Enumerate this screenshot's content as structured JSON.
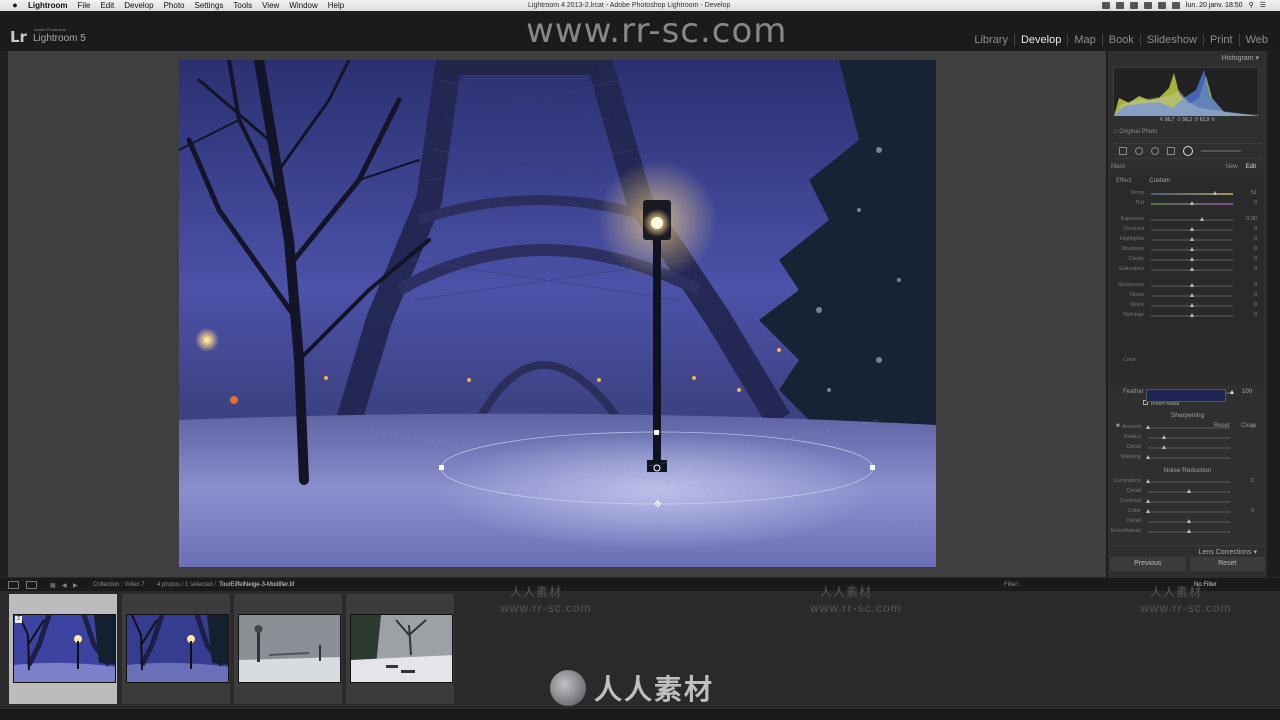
{
  "menubar": {
    "items": [
      "Lightroom",
      "File",
      "Edit",
      "Develop",
      "Photo",
      "Settings",
      "Tools",
      "View",
      "Window",
      "Help"
    ],
    "window_title": "Lightroom 4 2013-2.lrcat - Adobe Photoshop Lightroom - Develop",
    "datetime": "lun. 20 janv. 18:50"
  },
  "app": {
    "logo": "Lr",
    "logo_caption": "Adobe Photoshop",
    "name": "Lightroom 5",
    "watermark": "www.rr-sc.com"
  },
  "modules": [
    "Library",
    "Develop",
    "Map",
    "Book",
    "Slideshow",
    "Print",
    "Web"
  ],
  "active_module": "Develop",
  "histogram": {
    "title": "Histogram",
    "r_label": "R",
    "r_value": "56,7",
    "g_label": "G",
    "g_value": "56,2",
    "b_label": "B",
    "b_value": "62,9",
    "percent": "%"
  },
  "original_photo_label": "Original Photo",
  "mask": {
    "label": "Mask",
    "new_label": "New",
    "edit_label": "Edit",
    "effect_label": "Effect",
    "effect_value": "Custom",
    "sliders": [
      {
        "label": "Temp",
        "value": "51",
        "pos": 0.78
      },
      {
        "label": "Tint",
        "value": "0",
        "pos": 0.5
      },
      {
        "label": "Exposure",
        "value": "0,90",
        "pos": 0.62
      },
      {
        "label": "Contrast",
        "value": "0",
        "pos": 0.5
      },
      {
        "label": "Highlights",
        "value": "0",
        "pos": 0.5
      },
      {
        "label": "Shadows",
        "value": "0",
        "pos": 0.5
      },
      {
        "label": "Clarity",
        "value": "0",
        "pos": 0.5
      },
      {
        "label": "Saturation",
        "value": "0",
        "pos": 0.5
      },
      {
        "label": "Sharpness",
        "value": "0",
        "pos": 0.5
      },
      {
        "label": "Noise",
        "value": "0",
        "pos": 0.5
      },
      {
        "label": "Moiré",
        "value": "0",
        "pos": 0.5
      },
      {
        "label": "Defringe",
        "value": "0",
        "pos": 0.5
      }
    ],
    "color_label": "Color",
    "feather_label": "Feather",
    "feather_value": "100",
    "invert_label": "Invert Mask",
    "reset_label": "Reset",
    "close_label": "Close"
  },
  "sharpening": {
    "title": "Sharpening",
    "sliders": [
      {
        "label": "Amount",
        "value": "0",
        "pos": 0.0
      },
      {
        "label": "Radius",
        "value": "",
        "pos": 0.2
      },
      {
        "label": "Detail",
        "value": "",
        "pos": 0.2
      },
      {
        "label": "Masking",
        "value": "",
        "pos": 0.0
      }
    ]
  },
  "noise_reduction": {
    "title": "Noise Reduction",
    "sliders": [
      {
        "label": "Luminance",
        "value": "0",
        "pos": 0.0
      },
      {
        "label": "Detail",
        "value": "",
        "pos": 0.5
      },
      {
        "label": "Contrast",
        "value": "",
        "pos": 0.0
      },
      {
        "label": "Color",
        "value": "0",
        "pos": 0.0
      },
      {
        "label": "Detail",
        "value": "",
        "pos": 0.5
      },
      {
        "label": "Smoothness",
        "value": "",
        "pos": 0.5
      }
    ]
  },
  "lens_corrections": "Lens Corrections",
  "buttons": {
    "previous": "Previous",
    "reset": "Reset"
  },
  "filmbar": {
    "collection": "Collection : Video 7",
    "count": "4 photos / 1 selected /",
    "filename": "TourEiffelNeige-3-Modifier.tif",
    "filter_label": "Filter :",
    "filter_value": "No Filter"
  },
  "filmstrip": {
    "thumbnails": [
      {
        "badge": "2",
        "selected": true
      },
      {
        "badge": "",
        "selected": false
      },
      {
        "badge": "",
        "selected": false
      },
      {
        "badge": "",
        "selected": false
      }
    ]
  },
  "watermark_bottom": "人人素材",
  "watermark_small": [
    "人人素材",
    "www.rr-sc.com"
  ]
}
